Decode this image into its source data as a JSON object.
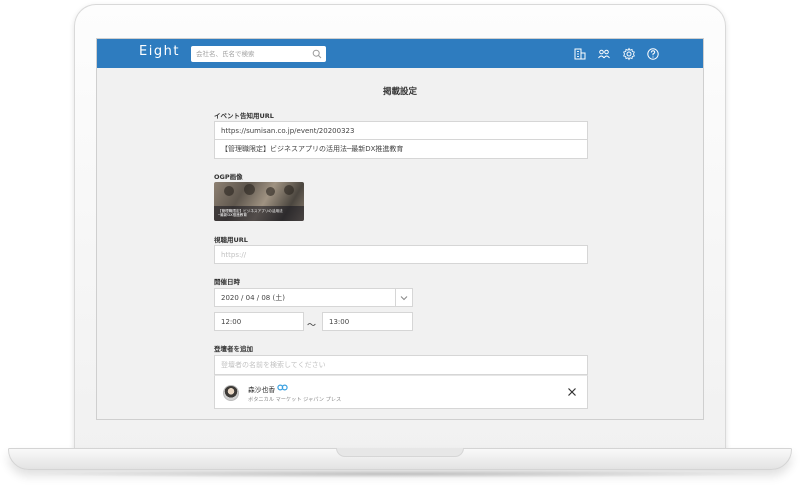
{
  "app": {
    "logo": "Eight"
  },
  "search": {
    "placeholder": "会社名、氏名で検索"
  },
  "nav_icons": [
    "company-icon",
    "people-icon",
    "gear-icon",
    "help-icon"
  ],
  "colors": {
    "navbar": "#2e7cbf",
    "accent": "#3aa0e0",
    "background": "#f1f1f1"
  },
  "page": {
    "title": "掲載設定"
  },
  "event_url": {
    "label": "イベント告知用URL",
    "url": "https://sumisan.co.jp/event/20200323",
    "title": "【管理職限定】ビジネスアプリの活用法─最新DX推進教育"
  },
  "ogp": {
    "label": "OGP画像",
    "caption_line1": "【管理職限定】ビジネスアプリの活用法",
    "caption_line2": "─最新DX推進教育"
  },
  "viewing_url": {
    "label": "視聴用URL",
    "placeholder": "https://"
  },
  "schedule": {
    "label": "開催日時",
    "date": "2020 / 04 / 08 (土)",
    "start_time": "12:00",
    "separator": "〜",
    "end_time": "13:00"
  },
  "speakers": {
    "label": "登壇者を追加",
    "search_placeholder": "登壇者の名前を検索してください",
    "items": [
      {
        "name": "森沙也香",
        "company": "ボタニカル マーケット ジャパン プレス"
      }
    ]
  }
}
